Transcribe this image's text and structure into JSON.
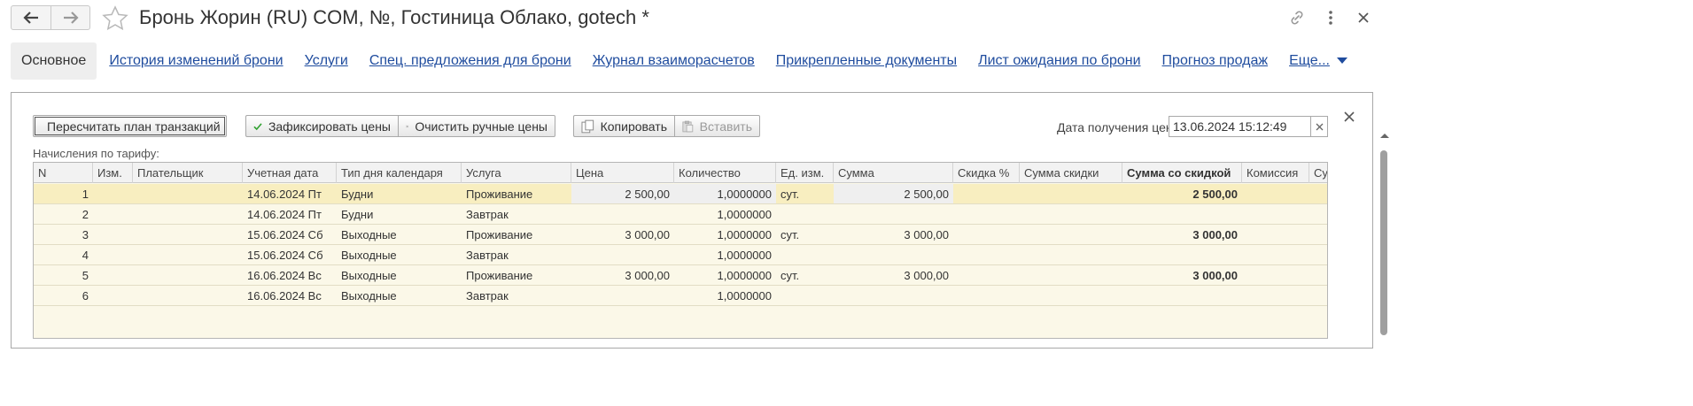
{
  "window": {
    "title": "Бронь Жорин (RU) COM, №, Гостиница Облако, gotech *"
  },
  "tabs": [
    {
      "label": "Основное",
      "active": true
    },
    {
      "label": "История изменений брони"
    },
    {
      "label": "Услуги"
    },
    {
      "label": "Спец. предложения для брони"
    },
    {
      "label": "Журнал взаиморасчетов"
    },
    {
      "label": "Прикрепленные документы"
    },
    {
      "label": "Лист ожидания по брони"
    },
    {
      "label": "Прогноз продаж"
    },
    {
      "label": "Еще..."
    }
  ],
  "toolbar": {
    "recalc_label": "Пересчитать план транзакций",
    "fix_prices_label": "Зафиксировать цены",
    "clear_manual_label": "Очистить ручные цены",
    "copy_label": "Копировать",
    "paste_label": "Вставить"
  },
  "price_date": {
    "label": "Дата получения цен:",
    "value": "13.06.2024 15:12:49"
  },
  "section_label": "Начисления по тарифу:",
  "grid": {
    "columns": [
      "N",
      "Изм.",
      "Плательщик",
      "Учетная дата",
      "Тип дня календаря",
      "Услуга",
      "Цена",
      "Количество",
      "Ед. изм.",
      "Сумма",
      "Скидка %",
      "Сумма скидки",
      "Сумма со скидкой",
      "Комиссия",
      "Су"
    ],
    "rows": [
      {
        "n": "1",
        "izm": "",
        "payer": "",
        "date": "14.06.2024 Пт",
        "daytype": "Будни",
        "service": "Проживание",
        "price": "2 500,00",
        "qty": "1,0000000",
        "unit": "сут.",
        "sum": "2 500,00",
        "disc_pct": "",
        "disc_sum": "",
        "sum_disc": "2 500,00",
        "commission": ""
      },
      {
        "n": "2",
        "izm": "",
        "payer": "",
        "date": "14.06.2024 Пт",
        "daytype": "Будни",
        "service": "Завтрак",
        "price": "",
        "qty": "1,0000000",
        "unit": "",
        "sum": "",
        "disc_pct": "",
        "disc_sum": "",
        "sum_disc": "",
        "commission": ""
      },
      {
        "n": "3",
        "izm": "",
        "payer": "",
        "date": "15.06.2024 Сб",
        "daytype": "Выходные",
        "service": "Проживание",
        "price": "3 000,00",
        "qty": "1,0000000",
        "unit": "сут.",
        "sum": "3 000,00",
        "disc_pct": "",
        "disc_sum": "",
        "sum_disc": "3 000,00",
        "commission": ""
      },
      {
        "n": "4",
        "izm": "",
        "payer": "",
        "date": "15.06.2024 Сб",
        "daytype": "Выходные",
        "service": "Завтрак",
        "price": "",
        "qty": "1,0000000",
        "unit": "",
        "sum": "",
        "disc_pct": "",
        "disc_sum": "",
        "sum_disc": "",
        "commission": ""
      },
      {
        "n": "5",
        "izm": "",
        "payer": "",
        "date": "16.06.2024 Вс",
        "daytype": "Выходные",
        "service": "Проживание",
        "price": "3 000,00",
        "qty": "1,0000000",
        "unit": "сут.",
        "sum": "3 000,00",
        "disc_pct": "",
        "disc_sum": "",
        "sum_disc": "3 000,00",
        "commission": ""
      },
      {
        "n": "6",
        "izm": "",
        "payer": "",
        "date": "16.06.2024 Вс",
        "daytype": "Выходные",
        "service": "Завтрак",
        "price": "",
        "qty": "1,0000000",
        "unit": "",
        "sum": "",
        "disc_pct": "",
        "disc_sum": "",
        "sum_disc": "",
        "commission": ""
      }
    ],
    "selected_row": 0
  },
  "icons": {
    "back": "arrow-left-icon",
    "forward": "arrow-right-icon",
    "favorite": "star-icon",
    "link": "link-icon",
    "more": "more-vertical-icon",
    "close": "close-icon",
    "recalc": "refresh-icon",
    "fix": "checkmark-icon",
    "clear": "x-icon",
    "copy": "copy-icon",
    "paste": "paste-icon",
    "more_tabs": "triangle-down-icon"
  },
  "colors": {
    "link": "#1f4c9e",
    "selected_row": "#f8eec0",
    "grid_bg": "#fbf8e8",
    "check": "#2ea12e",
    "recalc": "#2ea12e"
  }
}
